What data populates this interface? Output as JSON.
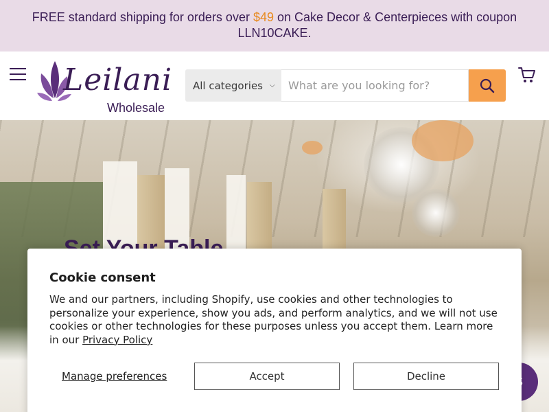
{
  "promo": {
    "text_before": "FREE standard shipping for orders over ",
    "price": "$49",
    "text_after": " on Cake Decor & Centerpieces with coupon LLN10CAKE."
  },
  "header": {
    "logo_word": "Leilani",
    "logo_sub": "Wholesale",
    "category_label": "All categories",
    "search_placeholder": "What are you looking for?"
  },
  "hero": {
    "title": "Set Your Table"
  },
  "chat": {
    "label": "S"
  },
  "cookie": {
    "title": "Cookie consent",
    "body_text": "We and our partners, including Shopify, use cookies and other technologies to personalize your experience, show you ads, and perform analytics, and we will not use cookies or other technologies for these purposes unless you accept them. Learn more in our ",
    "privacy_link": "Privacy Policy",
    "manage_label": "Manage preferences",
    "accept_label": "Accept",
    "decline_label": "Decline"
  },
  "colors": {
    "brand_purple": "#3a1d55",
    "promo_bg": "#e9dbe7",
    "price_orange": "#e88a1f",
    "search_button": "#f6a04d"
  },
  "icons": [
    "hamburger-menu-icon",
    "lotus-logo-icon",
    "chevron-down-icon",
    "search-icon",
    "cart-icon"
  ]
}
